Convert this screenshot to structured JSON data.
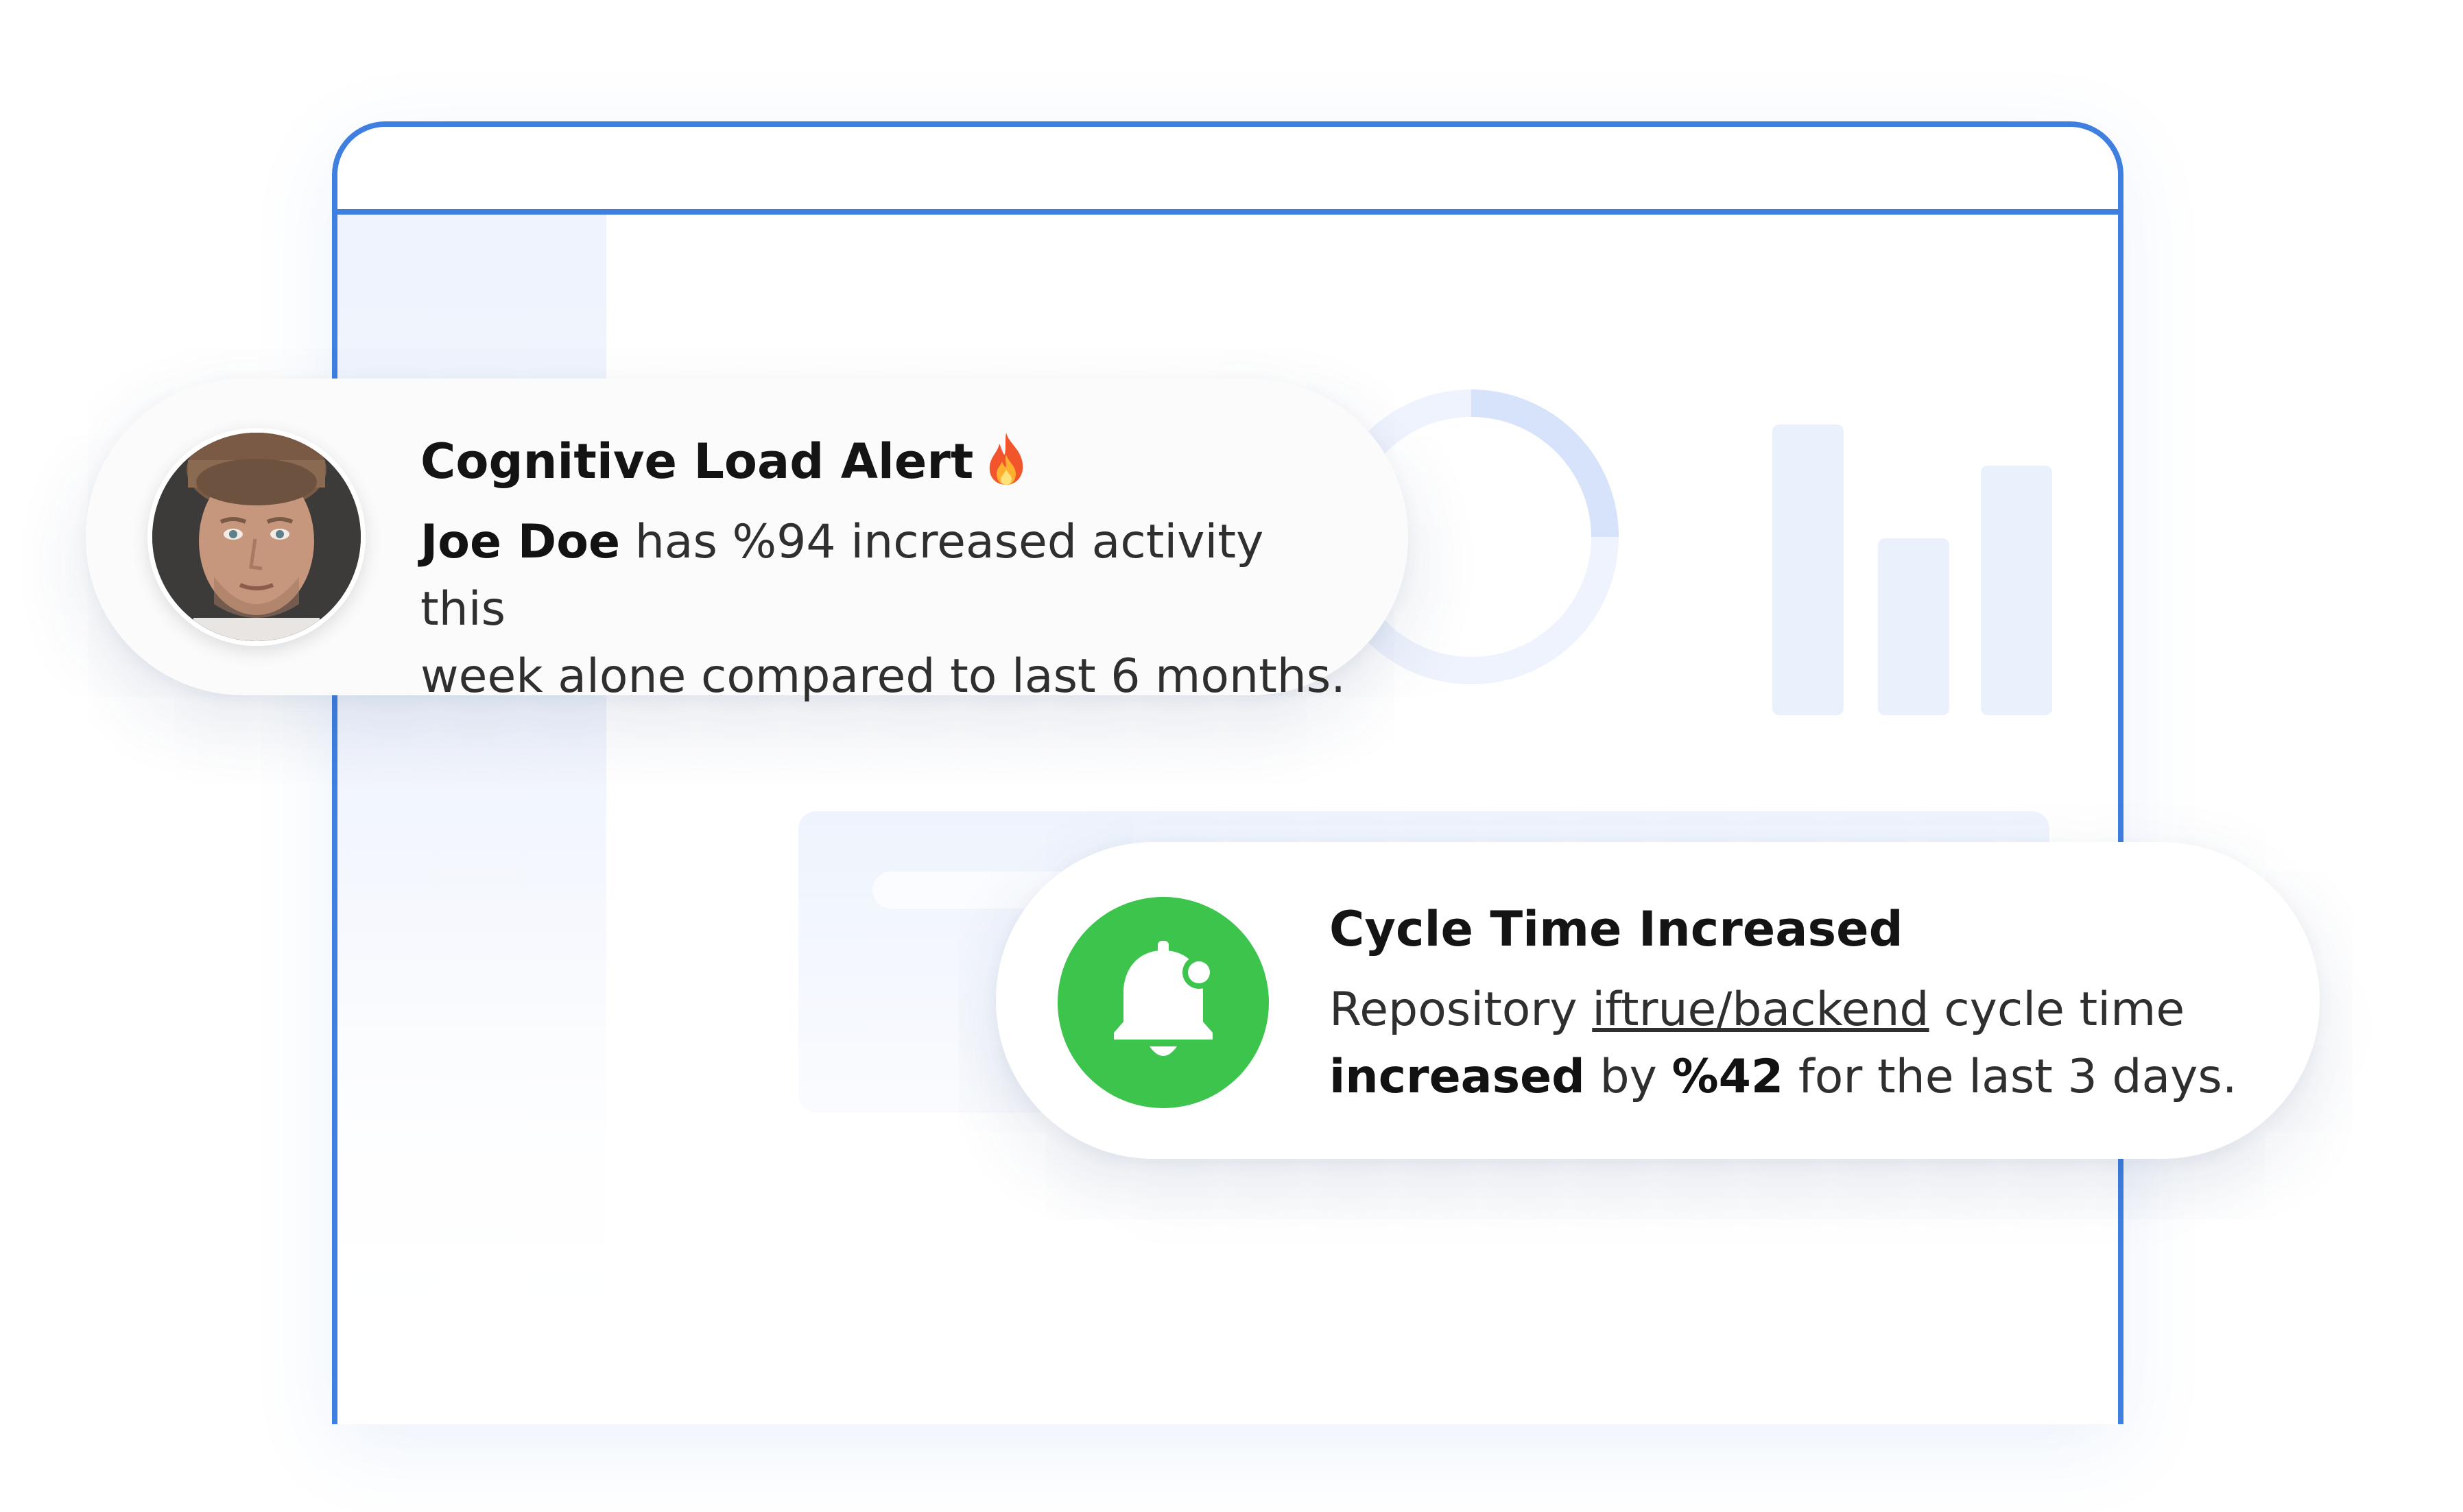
{
  "colors": {
    "frame_border": "#3f7fe0",
    "placeholder_blue": "#eaf0fc",
    "alert_green": "#3cc44c"
  },
  "cognitive_alert": {
    "title": "Cognitive Load Alert",
    "title_icon": "fire-icon",
    "person_name": "Joe Doe",
    "body_line_1": " has %94 increased activity this",
    "body_line_2": "week alone compared to last 6 months.",
    "avatar": "avatar-icon"
  },
  "cycle_alert": {
    "title": "Cycle Time Increased",
    "icon": "bell-notification-icon",
    "body_prefix": "Repository ",
    "repository": "iftrue/backend",
    "body_mid": " cycle time",
    "increase_word": "increased",
    "by_text": " by ",
    "percent": "%42",
    "body_suffix": " for the last 3 days."
  }
}
